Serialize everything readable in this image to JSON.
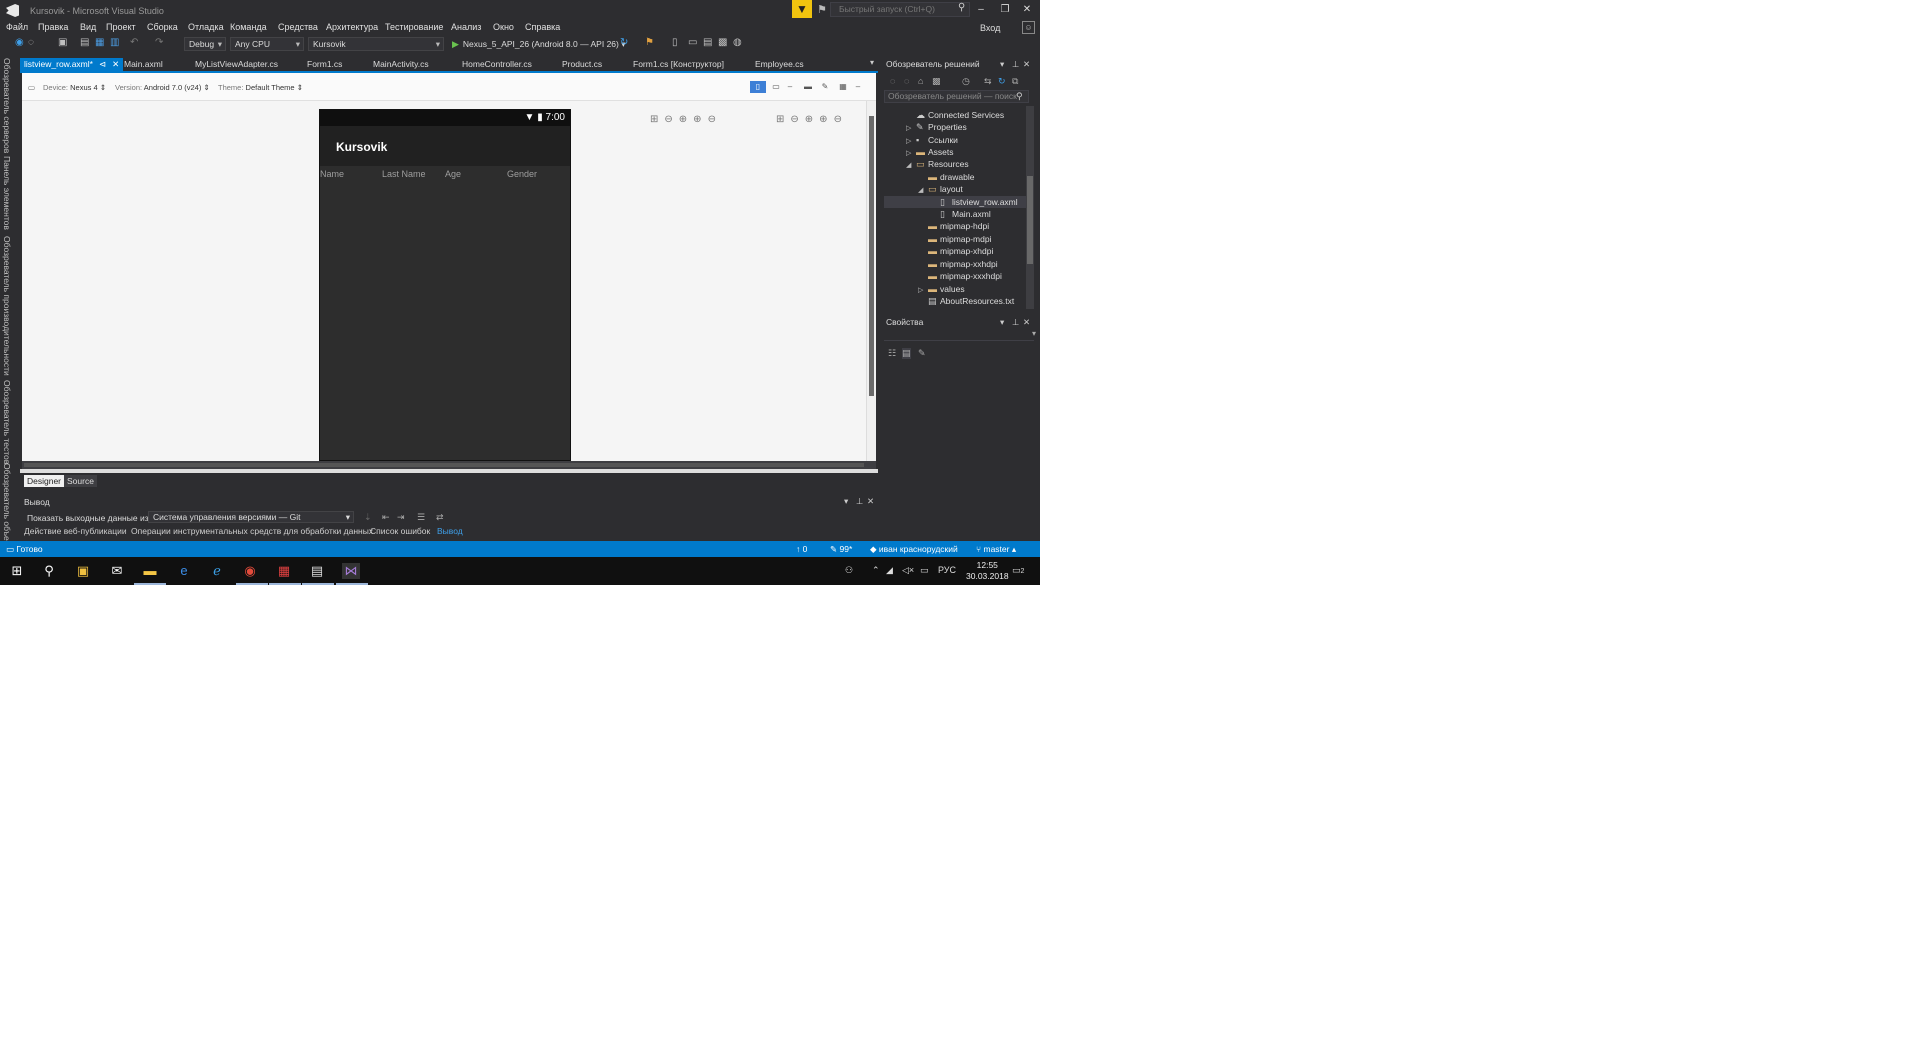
{
  "window": {
    "title": "Kursovik - Microsoft Visual Studio",
    "quick_launch_placeholder": "Быстрый запуск (Ctrl+Q)",
    "signin": "Вход"
  },
  "menu": [
    "Файл",
    "Правка",
    "Вид",
    "Проект",
    "Сборка",
    "Отладка",
    "Команда",
    "Средства",
    "Архитектура",
    "Тестирование",
    "Анализ",
    "Окно",
    "Справка"
  ],
  "toolbar": {
    "configuration": "Debug",
    "platform": "Any CPU",
    "startup_project": "Kursovik",
    "run_target": "Nexus_5_API_26 (Android 8.0 — API 26)"
  },
  "left_rail": [
    "Обозреватель серверов",
    "Панель элементов",
    "Обозреватель производительности",
    "Обозреватель тестов",
    "Обозреватель объектов"
  ],
  "doc_tabs": [
    {
      "label": "listview_row.axml*",
      "active": true
    },
    {
      "label": "Main.axml",
      "active": false
    },
    {
      "label": "MyListViewAdapter.cs",
      "active": false
    },
    {
      "label": "Form1.cs",
      "active": false
    },
    {
      "label": "MainActivity.cs",
      "active": false
    },
    {
      "label": "HomeController.cs",
      "active": false
    },
    {
      "label": "Product.cs",
      "active": false
    },
    {
      "label": "Form1.cs [Конструктор]",
      "active": false
    },
    {
      "label": "Employee.cs",
      "active": false
    }
  ],
  "designer_bar": {
    "device_label": "Device:",
    "device": "Nexus 4",
    "version_label": "Version:",
    "version": "Android 7.0 (v24)",
    "theme_label": "Theme:",
    "theme": "Default Theme"
  },
  "phone": {
    "time": "7:00",
    "app_title": "Kursovik",
    "columns": [
      "Name",
      "Last Name",
      "Age",
      "Gender"
    ]
  },
  "designer_tabs": [
    "Designer",
    "Source"
  ],
  "output": {
    "title": "Вывод",
    "show_label": "Показать выходные данные из:",
    "source": "Система управления версиями — Git",
    "bottom_tabs": [
      "Действие веб-публикации",
      "Операции инструментальных средств для обработки данных",
      "Список ошибок",
      "Вывод"
    ]
  },
  "solution_explorer": {
    "title": "Обозреватель решений",
    "search_placeholder": "Обозреватель решений — поиск",
    "tree": [
      {
        "label": "Connected Services",
        "icon": "cloud",
        "arrow": ""
      },
      {
        "label": "Properties",
        "icon": "wrench",
        "arrow": "▷"
      },
      {
        "label": "Ссылки",
        "icon": "refs",
        "arrow": "▷"
      },
      {
        "label": "Assets",
        "icon": "folder",
        "arrow": "▷"
      },
      {
        "label": "Resources",
        "icon": "folder-open",
        "arrow": "◢"
      },
      {
        "label": "drawable",
        "icon": "folder",
        "arrow": ""
      },
      {
        "label": "layout",
        "icon": "folder-open",
        "arrow": "◢"
      },
      {
        "label": "listview_row.axml",
        "icon": "file",
        "arrow": "",
        "selected": true
      },
      {
        "label": "Main.axml",
        "icon": "file",
        "arrow": ""
      },
      {
        "label": "mipmap-hdpi",
        "icon": "folder",
        "arrow": ""
      },
      {
        "label": "mipmap-mdpi",
        "icon": "folder",
        "arrow": ""
      },
      {
        "label": "mipmap-xhdpi",
        "icon": "folder",
        "arrow": ""
      },
      {
        "label": "mipmap-xxhdpi",
        "icon": "folder",
        "arrow": ""
      },
      {
        "label": "mipmap-xxxhdpi",
        "icon": "folder",
        "arrow": ""
      },
      {
        "label": "values",
        "icon": "folder",
        "arrow": "▷"
      },
      {
        "label": "AboutResources.txt",
        "icon": "file",
        "arrow": ""
      }
    ]
  },
  "properties": {
    "title": "Свойства"
  },
  "statusbar": {
    "ready": "Готово",
    "up_count": "0",
    "pending_count": "99*",
    "repo": "иван краснорудский",
    "branch": "master"
  },
  "taskbar": {
    "language": "РУС",
    "time": "12:55",
    "date": "30.03.2018",
    "notifications": "2"
  },
  "colors": {
    "accent": "#007acc",
    "background": "#2d2d30",
    "filter": "#f1c40f"
  }
}
